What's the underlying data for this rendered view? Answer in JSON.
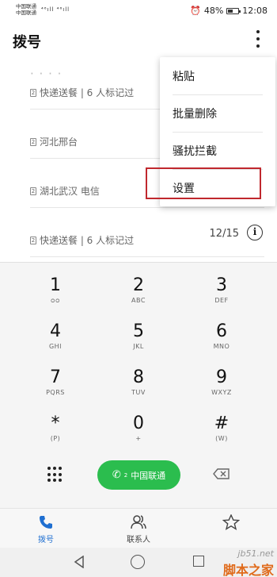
{
  "status": {
    "carrier1": "中国联通",
    "carrier2": "中国联通",
    "signal": "⁴⁶ıll ⁴⁶ıll",
    "battery": "48%",
    "time": "12:08"
  },
  "header": {
    "title": "拨号"
  },
  "calls": [
    {
      "subtitle": "快递送餐 | 6 人标记过",
      "date": ""
    },
    {
      "subtitle": "河北邢台",
      "date": ""
    },
    {
      "subtitle": "湖北武汉 电信",
      "date": ""
    },
    {
      "subtitle": "快递送餐 | 6 人标记过",
      "date": "12/15"
    }
  ],
  "menu": {
    "items": [
      "粘贴",
      "批量删除",
      "骚扰拦截",
      "设置"
    ]
  },
  "dialpad": {
    "keys": [
      {
        "digit": "1",
        "letters": "ᴑᴑ"
      },
      {
        "digit": "2",
        "letters": "ABC"
      },
      {
        "digit": "3",
        "letters": "DEF"
      },
      {
        "digit": "4",
        "letters": "GHI"
      },
      {
        "digit": "5",
        "letters": "JKL"
      },
      {
        "digit": "6",
        "letters": "MNO"
      },
      {
        "digit": "7",
        "letters": "PQRS"
      },
      {
        "digit": "8",
        "letters": "TUV"
      },
      {
        "digit": "9",
        "letters": "WXYZ"
      },
      {
        "digit": "*",
        "letters": "(P)"
      },
      {
        "digit": "0",
        "letters": "+"
      },
      {
        "digit": "#",
        "letters": "(W)"
      }
    ],
    "call_label": "中国联通",
    "call_sim": "2"
  },
  "bottomnav": {
    "items": [
      {
        "label": "拨号",
        "active": true
      },
      {
        "label": "联系人",
        "active": false
      },
      {
        "label": "",
        "active": false
      }
    ]
  },
  "watermark": {
    "top": "jb51.net",
    "bottom": "脚本之家"
  },
  "colors": {
    "accent": "#1f6fd1",
    "call_green": "#2bbd4e",
    "highlight_red": "#c0282e"
  }
}
